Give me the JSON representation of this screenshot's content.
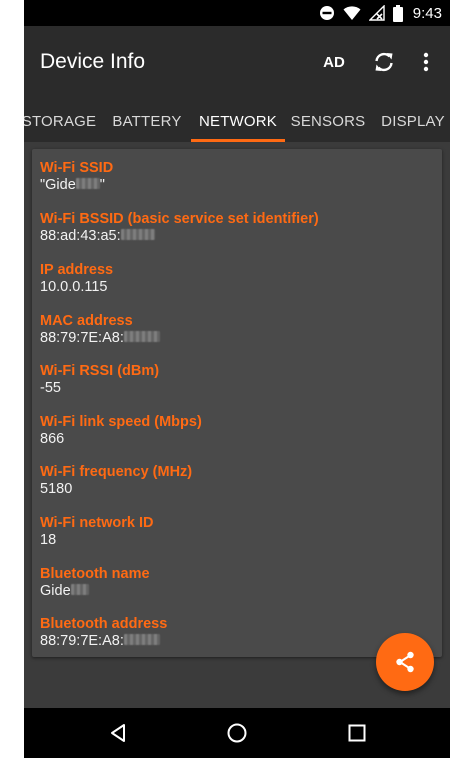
{
  "status_bar": {
    "time": "9:43",
    "icons": [
      "do-not-disturb-icon",
      "wifi-icon",
      "no-signal-icon",
      "battery-icon"
    ]
  },
  "toolbar": {
    "title": "Device Info",
    "ad_label": "AD",
    "actions": [
      "refresh-icon",
      "more-vert-icon"
    ]
  },
  "tabs": [
    {
      "label": "STORAGE",
      "active": false
    },
    {
      "label": "BATTERY",
      "active": false
    },
    {
      "label": "NETWORK",
      "active": true
    },
    {
      "label": "SENSORS",
      "active": false
    },
    {
      "label": "DISPLAY",
      "active": false
    }
  ],
  "network_info": [
    {
      "label": "Wi-Fi SSID",
      "value": "\"Gide",
      "value_suffix": "\""
    },
    {
      "label": "Wi-Fi BSSID (basic service set identifier)",
      "value": "88:ad:43:a5:",
      "value_suffix": ""
    },
    {
      "label": "IP address",
      "value": "10.0.0.115",
      "value_suffix": ""
    },
    {
      "label": "MAC address",
      "value": "88:79:7E:A8:",
      "value_suffix": ""
    },
    {
      "label": "Wi-Fi RSSI (dBm)",
      "value": "-55",
      "value_suffix": ""
    },
    {
      "label": "Wi-Fi link speed (Mbps)",
      "value": "866",
      "value_suffix": ""
    },
    {
      "label": "Wi-Fi frequency (MHz)",
      "value": "5180",
      "value_suffix": ""
    },
    {
      "label": "Wi-Fi network ID",
      "value": "18",
      "value_suffix": ""
    },
    {
      "label": "Bluetooth name",
      "value": "Gide",
      "value_suffix": ""
    },
    {
      "label": "Bluetooth address",
      "value": "88:79:7E:A8:",
      "value_suffix": ""
    }
  ],
  "fab": {
    "icon": "share-icon"
  },
  "nav_bar": {
    "buttons": [
      "back-icon",
      "home-icon",
      "recents-icon"
    ]
  },
  "colors": {
    "accent": "#ff6a13",
    "toolbar": "#2b2b2b",
    "background": "#3b3b3b",
    "card": "#4a4a4a"
  }
}
